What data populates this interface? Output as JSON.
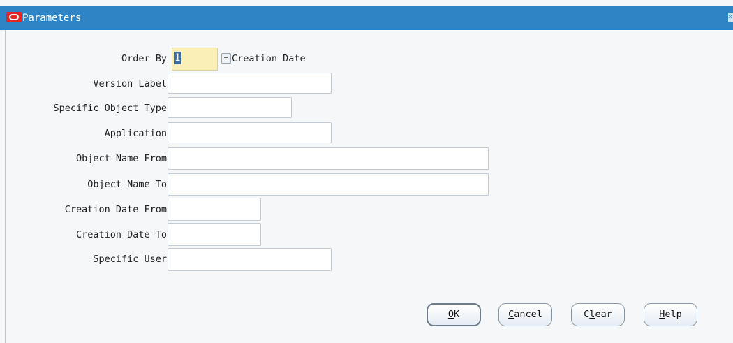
{
  "window": {
    "title": "Parameters"
  },
  "order_by": {
    "label": "Order By",
    "value": "1",
    "description": "Creation Date"
  },
  "fields": {
    "version_label": "Version Label",
    "specific_object_type": "Specific Object Type",
    "application": "Application",
    "object_name_from": "Object Name From",
    "object_name_to": "Object Name To",
    "creation_date_from": "Creation Date From",
    "creation_date_to": "Creation Date To",
    "specific_user": "Specific User"
  },
  "buttons": {
    "ok": {
      "pre": "",
      "mnemonic": "O",
      "post": "K"
    },
    "cancel": {
      "pre": "",
      "mnemonic": "C",
      "post": "ancel"
    },
    "clear": {
      "pre": "C",
      "mnemonic": "l",
      "post": "ear"
    },
    "help": {
      "pre": "",
      "mnemonic": "H",
      "post": "elp"
    }
  },
  "colors": {
    "titlebar": "#2f84c5",
    "required_field": "#fbefb8",
    "selection": "#3f6c9a"
  },
  "icons": {
    "logo": "oracle-logo-icon",
    "lov": "ellipsis-icon"
  }
}
